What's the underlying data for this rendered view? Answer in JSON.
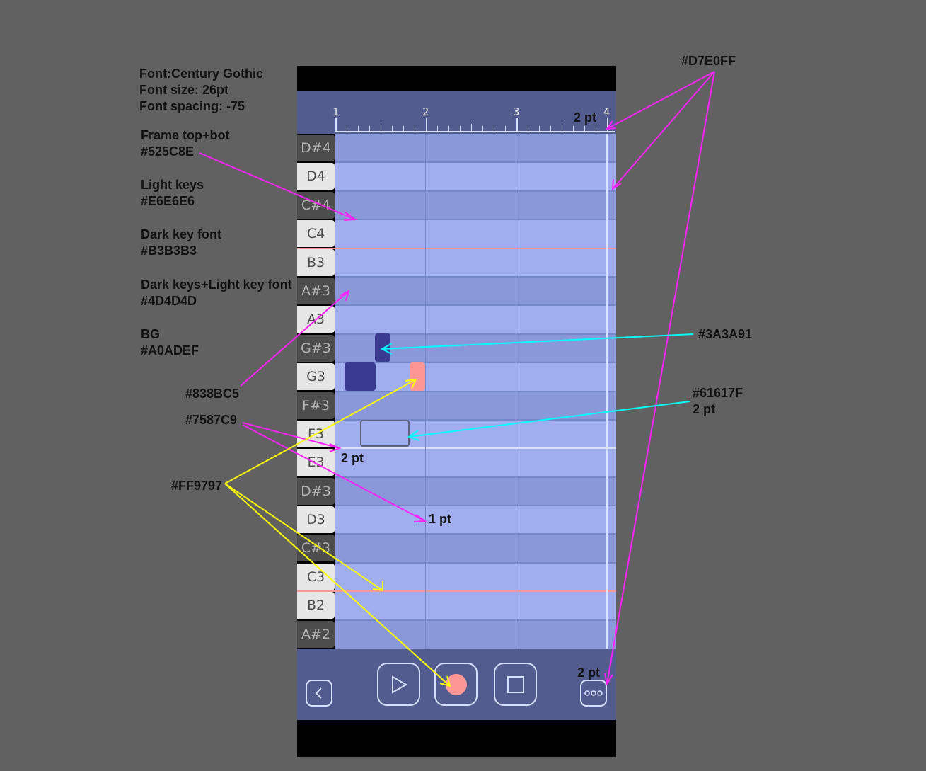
{
  "specs": {
    "font_lines": [
      "Font:Century Gothic",
      "Font size: 26pt",
      "Font spacing: -75"
    ],
    "frame_label": "Frame top+bot",
    "frame_color": "#525C8E",
    "light_keys_label": "Light keys",
    "light_keys_color": "#E6E6E6",
    "dark_key_font_label": "Dark key font",
    "dark_key_font_color": "#B3B3B3",
    "dark_keys_label": "Dark keys+Light key font",
    "dark_keys_color": "#4D4D4D",
    "bg_label": "BG",
    "bg_color": "#A0ADEF",
    "dark_lane_color": "#838BC5",
    "grid_color": "#7587C9",
    "accent_color": "#FF9797",
    "highlight_color": "#D7E0FF",
    "note_color": "#3A3A91",
    "outline_color": "#61617F",
    "outline_width": "2 pt",
    "two_pt_a": "2 pt",
    "two_pt_b": "2 pt",
    "two_pt_c": "2 pt",
    "one_pt": "1 pt"
  },
  "ruler": {
    "labels": [
      "1",
      "2",
      "3",
      "4"
    ]
  },
  "keys": [
    {
      "label": "D#4",
      "type": "dark"
    },
    {
      "label": "D4",
      "type": "light"
    },
    {
      "label": "C#4",
      "type": "dark"
    },
    {
      "label": "C4",
      "type": "light"
    },
    {
      "label": "B3",
      "type": "light"
    },
    {
      "label": "A#3",
      "type": "dark"
    },
    {
      "label": "A3",
      "type": "light"
    },
    {
      "label": "G#3",
      "type": "dark"
    },
    {
      "label": "G3",
      "type": "light"
    },
    {
      "label": "F#3",
      "type": "dark"
    },
    {
      "label": "F3",
      "type": "light"
    },
    {
      "label": "E3",
      "type": "light"
    },
    {
      "label": "D#3",
      "type": "dark"
    },
    {
      "label": "D3",
      "type": "light"
    },
    {
      "label": "C#3",
      "type": "dark"
    },
    {
      "label": "C3",
      "type": "light"
    },
    {
      "label": "B2",
      "type": "light"
    },
    {
      "label": "A#2",
      "type": "dark"
    }
  ],
  "controls": {
    "back": "back",
    "play": "play",
    "record": "record",
    "stop": "stop",
    "more": "more"
  }
}
